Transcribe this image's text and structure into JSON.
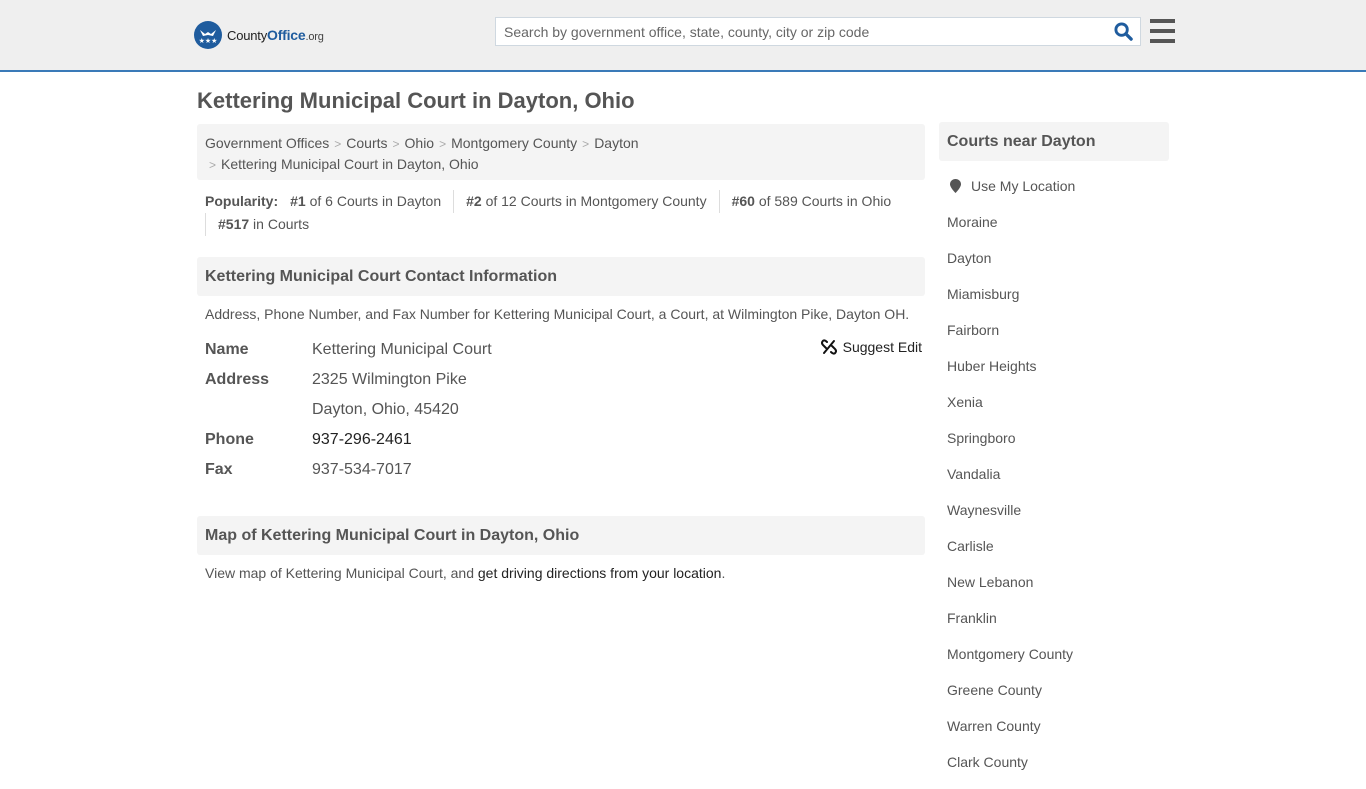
{
  "header": {
    "logo": {
      "prefix": "County",
      "brand": "Office",
      "suffix": ".org"
    },
    "search": {
      "placeholder": "Search by government office, state, county, city or zip code",
      "value": ""
    },
    "search_icon": "search-icon",
    "menu_icon": "hamburger-menu-icon",
    "accent_color": "#3a7ab8"
  },
  "page": {
    "title": "Kettering Municipal Court in Dayton, Ohio"
  },
  "breadcrumb": {
    "items": [
      "Government Offices",
      "Courts",
      "Ohio",
      "Montgomery County",
      "Dayton"
    ],
    "current": "Kettering Municipal Court in Dayton, Ohio",
    "separator": ">"
  },
  "popularity": {
    "label": "Popularity:",
    "items": [
      {
        "rank": "#1",
        "text": "of 6 Courts in Dayton"
      },
      {
        "rank": "#2",
        "text": "of 12 Courts in Montgomery County"
      },
      {
        "rank": "#60",
        "text": "of 589 Courts in Ohio"
      },
      {
        "rank": "#517",
        "text": "in Courts"
      }
    ]
  },
  "contact": {
    "heading": "Kettering Municipal Court Contact Information",
    "description": "Address, Phone Number, and Fax Number for Kettering Municipal Court, a Court, at Wilmington Pike, Dayton OH.",
    "suggest_edit": "Suggest Edit",
    "rows": {
      "name": {
        "label": "Name",
        "value": "Kettering Municipal Court"
      },
      "address": {
        "label": "Address",
        "line1": "2325 Wilmington Pike",
        "line2": "Dayton, Ohio, 45420"
      },
      "phone": {
        "label": "Phone",
        "value": "937-296-2461"
      },
      "fax": {
        "label": "Fax",
        "value": "937-534-7017"
      }
    }
  },
  "map": {
    "heading": "Map of Kettering Municipal Court in Dayton, Ohio",
    "desc_prefix": "View map of Kettering Municipal Court, and ",
    "link": "get driving directions from your location",
    "desc_suffix": "."
  },
  "sidebar": {
    "heading": "Courts near Dayton",
    "use_location": "Use My Location",
    "links": [
      "Moraine",
      "Dayton",
      "Miamisburg",
      "Fairborn",
      "Huber Heights",
      "Xenia",
      "Springboro",
      "Vandalia",
      "Waynesville",
      "Carlisle",
      "New Lebanon",
      "Franklin",
      "Montgomery County",
      "Greene County",
      "Warren County",
      "Clark County"
    ]
  }
}
